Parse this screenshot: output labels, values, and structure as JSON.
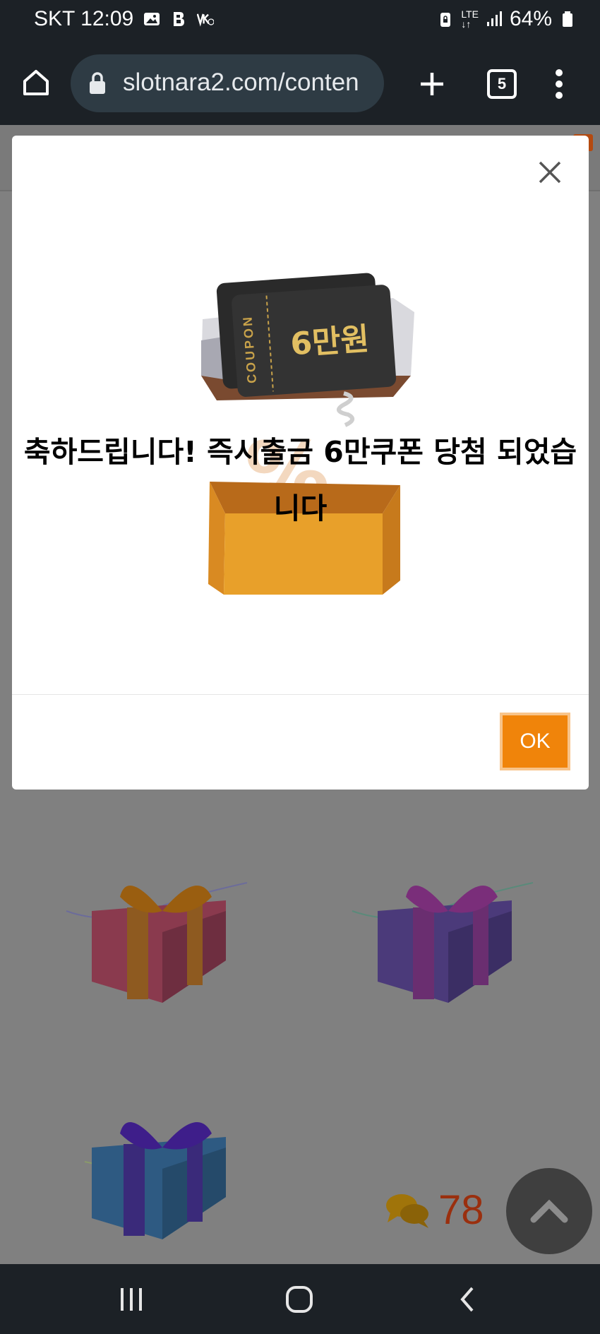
{
  "status_bar": {
    "carrier_time": "SKT 12:09",
    "network": "LTE",
    "battery": "64%",
    "icons": [
      "gallery-icon",
      "b-app-icon",
      "volte-icon",
      "lock-battery-icon",
      "lte-icon",
      "signal-icon",
      "battery-icon"
    ]
  },
  "browser": {
    "url": "slotnara2.com/conten",
    "tab_count": "5",
    "icons": [
      "home-icon",
      "lock-icon",
      "new-tab-icon",
      "tabs-icon",
      "more-icon"
    ]
  },
  "modal": {
    "message": "축하드립니다! 즉시출금 6만쿠폰 당첨 되었습니다",
    "coupon_label": "COUPON",
    "coupon_amount": "6만원",
    "ok_label": "OK",
    "accent_color": "#f0840a"
  },
  "page": {
    "comment_count": "78",
    "gift_boxes": [
      "red-gift-box",
      "purple-gift-box",
      "blue-gift-box"
    ]
  },
  "nav_bar": {
    "icons": [
      "recent-apps-icon",
      "home-button-icon",
      "back-icon"
    ]
  }
}
